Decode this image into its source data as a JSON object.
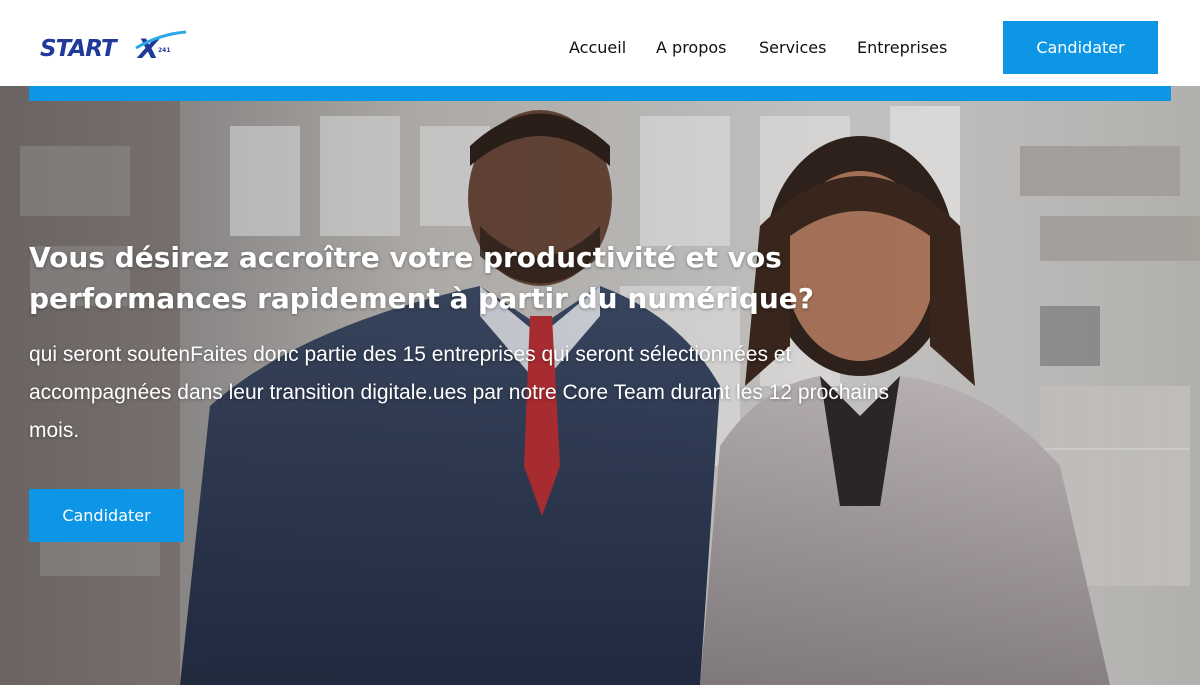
{
  "colors": {
    "accent": "#0d96e5",
    "nav_text": "#111111",
    "hero_text": "#ffffff",
    "logo_navy": "#1f3a9a",
    "logo_light_blue": "#2aa8e6"
  },
  "header": {
    "logo": {
      "text": "START",
      "mark": "X",
      "tag": "241",
      "icon": "startx-logo"
    },
    "nav": [
      {
        "label": "Accueil"
      },
      {
        "label": "A propos"
      },
      {
        "label": "Services"
      },
      {
        "label": "Entreprises"
      }
    ],
    "cta_label": "Candidater"
  },
  "hero": {
    "title": "Vous désirez accroître votre productivité et vos performances  rapidement à partir du numérique?",
    "subtitle": "qui seront soutenFaites donc partie des 15 entreprises qui seront sélectionnées et accompagnées dans leur transition digitale.ues par notre Core Team durant les 12 prochains mois.",
    "cta_label": "Candidater",
    "image": "business-people-photo"
  }
}
